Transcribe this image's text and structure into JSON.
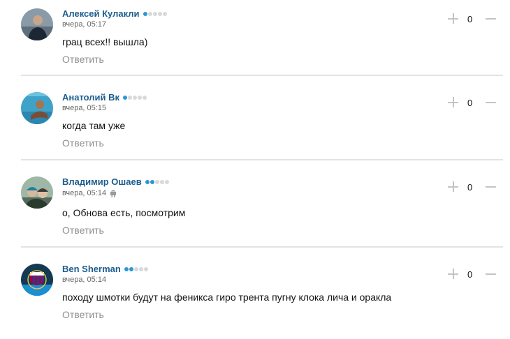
{
  "reply_label": "Ответить",
  "colors": {
    "author": "#1d5d8f",
    "rating_on": "#2a97d8",
    "rating_off": "#d9d9d9",
    "reply": "#8f8f8f",
    "divider": "#e3e3e3"
  },
  "comments": [
    {
      "author": "Алексей Кулакли",
      "rating_filled": 1,
      "rating_total": 5,
      "time": "вчера, 05:17",
      "device": "",
      "text": "грац всех!! вышла)",
      "reply": "Ответить",
      "score": "0"
    },
    {
      "author": "Анатолий Вк",
      "rating_filled": 1,
      "rating_total": 5,
      "time": "вчера, 05:15",
      "device": "",
      "text": "когда там уже",
      "reply": "Ответить",
      "score": "0"
    },
    {
      "author": "Владимир Ошаев",
      "rating_filled": 2,
      "rating_total": 5,
      "time": "вчера, 05:14",
      "device": "android-icon",
      "text": "о, Обнова есть, посмотрим",
      "reply": "Ответить",
      "score": "0"
    },
    {
      "author": "Ben Sherman",
      "rating_filled": 2,
      "rating_total": 5,
      "time": "вчера, 05:14",
      "device": "",
      "text": "походу шмотки будут на феникса гиро трента пугну клока лича и оракла",
      "reply": "Ответить",
      "score": "0"
    }
  ]
}
